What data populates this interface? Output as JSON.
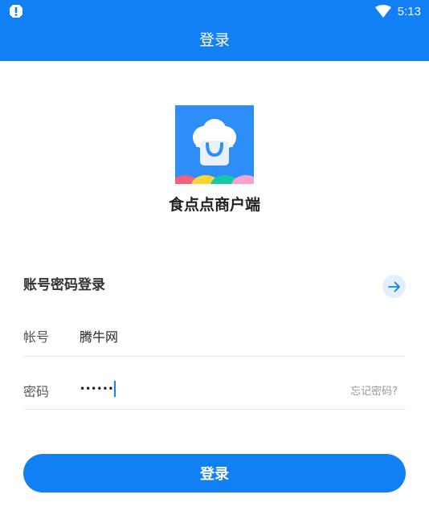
{
  "status_bar": {
    "time": "5:13",
    "icons": [
      "alert-icon",
      "wifi-icon"
    ]
  },
  "header": {
    "title": "登录"
  },
  "app": {
    "name": "食点点商户端",
    "logo_icon": "chef-hat-icon",
    "brand_color": "#1180f5"
  },
  "login_form": {
    "section_title": "账号密码登录",
    "switch_icon": "arrow-right-icon",
    "account": {
      "label": "帐号",
      "value": "腾牛网"
    },
    "password": {
      "label": "密码",
      "value_masked": "••••••",
      "forgot_label": "忘记密码?"
    },
    "submit_label": "登录"
  }
}
